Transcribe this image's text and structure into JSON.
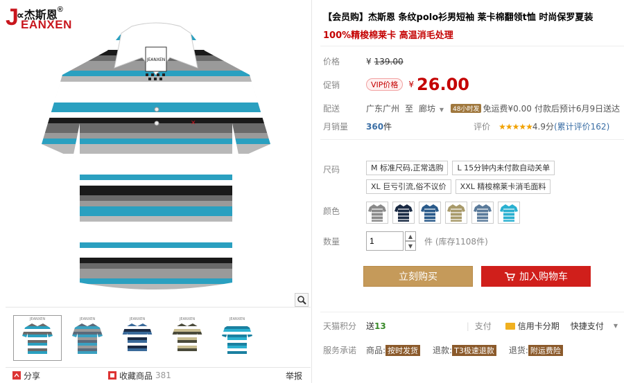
{
  "brand": {
    "logo_top": "杰斯恩",
    "logo_reg": "®",
    "logo_letter": "J",
    "logo_bottom": "EANXEN"
  },
  "product": {
    "title": "【会员购】杰斯恩 条纹polo衫男短袖 莱卡棉翻领t恤 时尚保罗夏装",
    "subtitle": "100%精梭棉莱卡 高温消毛处理"
  },
  "pricing": {
    "orig_label": "价格",
    "orig_currency": "¥",
    "orig_price": "139.00",
    "promo_label": "促销",
    "vip_badge": "VIP价格",
    "promo_currency": "¥",
    "promo_price": "26.00"
  },
  "shipping": {
    "label": "配送",
    "from": "广东广州",
    "to_word": "至",
    "dest": "廊坊",
    "dest_arrow": "▼",
    "tag": "48小时发",
    "fee": "免运费¥0.00",
    "eta": "付款后预计6月9日送达"
  },
  "sales": {
    "label": "月销量",
    "count": "360",
    "unit": "件",
    "review_label": "评价",
    "stars": "★★★★★",
    "rating": "4.9分",
    "reviews": "(累计评价162)"
  },
  "options": {
    "size_label": "尺码",
    "sizes": [
      "M 标准尺码,正常选购",
      "L 15分钟内未付款自动关单",
      "XL 巨亏引流,俗不议价",
      "XXL 精梭棉莱卡消毛面料"
    ],
    "color_label": "颜色",
    "colors": [
      {
        "name": "gray",
        "hex": "#8a8a8a"
      },
      {
        "name": "navy",
        "hex": "#1a2a44"
      },
      {
        "name": "blue",
        "hex": "#2a5a8a"
      },
      {
        "name": "khaki",
        "hex": "#a89a6a"
      },
      {
        "name": "steel",
        "hex": "#5a7a9a"
      },
      {
        "name": "cyan",
        "hex": "#2ab0d0"
      }
    ],
    "qty_label": "数量",
    "qty_value": "1",
    "qty_unit": "件",
    "stock": "(库存1108件)"
  },
  "actions": {
    "buy": "立刻购买",
    "cart": "加入购物车"
  },
  "extras": {
    "points_label": "天猫积分",
    "points_prefix": "送",
    "points_value": "13",
    "pay_label": "支付",
    "pay_credit": "信用卡分期",
    "pay_quick": "快捷支付",
    "pay_arrow": "▼",
    "service_label": "服务承诺",
    "service_items": [
      {
        "prefix": "商品:",
        "tag": "按时发货"
      },
      {
        "prefix": "退款:",
        "tag": "T3极速退款"
      },
      {
        "prefix": "退货:",
        "tag": "附运费险"
      }
    ]
  },
  "gallery": {
    "thumb_brand": "JEANXEN",
    "thumbs": [
      {
        "name": "gray-stripe",
        "base": "#ffffff",
        "stripe": "#6a6a6a",
        "accent": "#2aa0c0"
      },
      {
        "name": "gray-stripe-2",
        "base": "#9a9a9a",
        "stripe": "#5a6a7a",
        "accent": "#3aa0c0"
      },
      {
        "name": "navy-stripe",
        "base": "#1a2a44",
        "stripe": "#3a6a9a",
        "accent": "#ffffff"
      },
      {
        "name": "khaki-stripe",
        "base": "#c8bc90",
        "stripe": "#4a4a3a",
        "accent": "#ffffff"
      },
      {
        "name": "cyan-stripe",
        "base": "#2ab0d0",
        "stripe": "#ffffff",
        "accent": "#1a80a0"
      }
    ],
    "main_logo": "JEANXEN"
  },
  "footer": {
    "share": "分享",
    "favorite": "收藏商品",
    "fav_count": "381",
    "report": "举报"
  },
  "colors": {
    "red": "#c40000",
    "buy": "#c59a5a",
    "cart": "#d01f1b"
  }
}
